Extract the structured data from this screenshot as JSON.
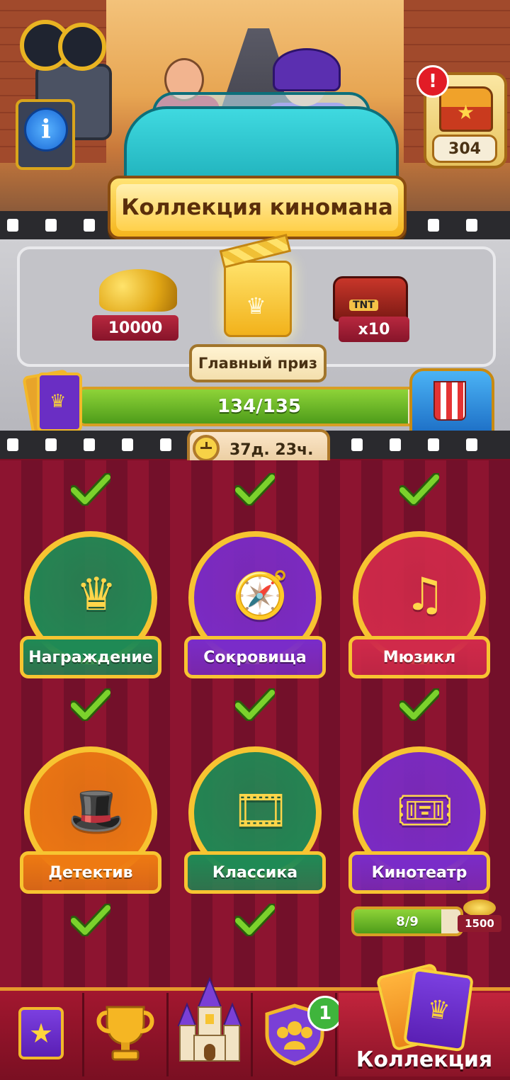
{
  "header": {
    "title": "Коллекция киномана",
    "chest_count": "304",
    "alert_mark": "!",
    "info_mark": "i"
  },
  "rewards": {
    "coins_amount": "10000",
    "tnt_label": "TNT",
    "tnt_amount": "x10",
    "grand_prize_label": "Главный приз"
  },
  "progress": {
    "text": "134/135",
    "current": 134,
    "total": 135
  },
  "timer": {
    "text": "37д. 23ч."
  },
  "collections": [
    {
      "label": "Награждение",
      "completed": true,
      "color": "#1f8a55"
    },
    {
      "label": "Сокровища",
      "completed": true,
      "color": "#7a2cc9"
    },
    {
      "label": "Мюзикл",
      "completed": true,
      "color": "#d02a4a"
    },
    {
      "label": "Детектив",
      "completed": true,
      "color": "#ee7a12"
    },
    {
      "label": "Классика",
      "completed": true,
      "color": "#1f8a55"
    },
    {
      "label": "Кинотеатр",
      "completed": false,
      "color": "#7a2cc9"
    }
  ],
  "kinoteatr_progress": {
    "text": "8/9",
    "current": 8,
    "total": 9,
    "reward": "1500"
  },
  "nav": {
    "items": [
      {
        "icon": "star-book-icon"
      },
      {
        "icon": "trophy-icon"
      },
      {
        "icon": "castle-icon"
      },
      {
        "icon": "team-shield-icon",
        "badge": "1"
      },
      {
        "icon": "cards-icon",
        "label": "Коллекция",
        "active": true
      }
    ]
  },
  "colors": {
    "accent_gold": "#f7c431",
    "curtain": "#8d1430",
    "progress_green": "#6bb52a"
  }
}
